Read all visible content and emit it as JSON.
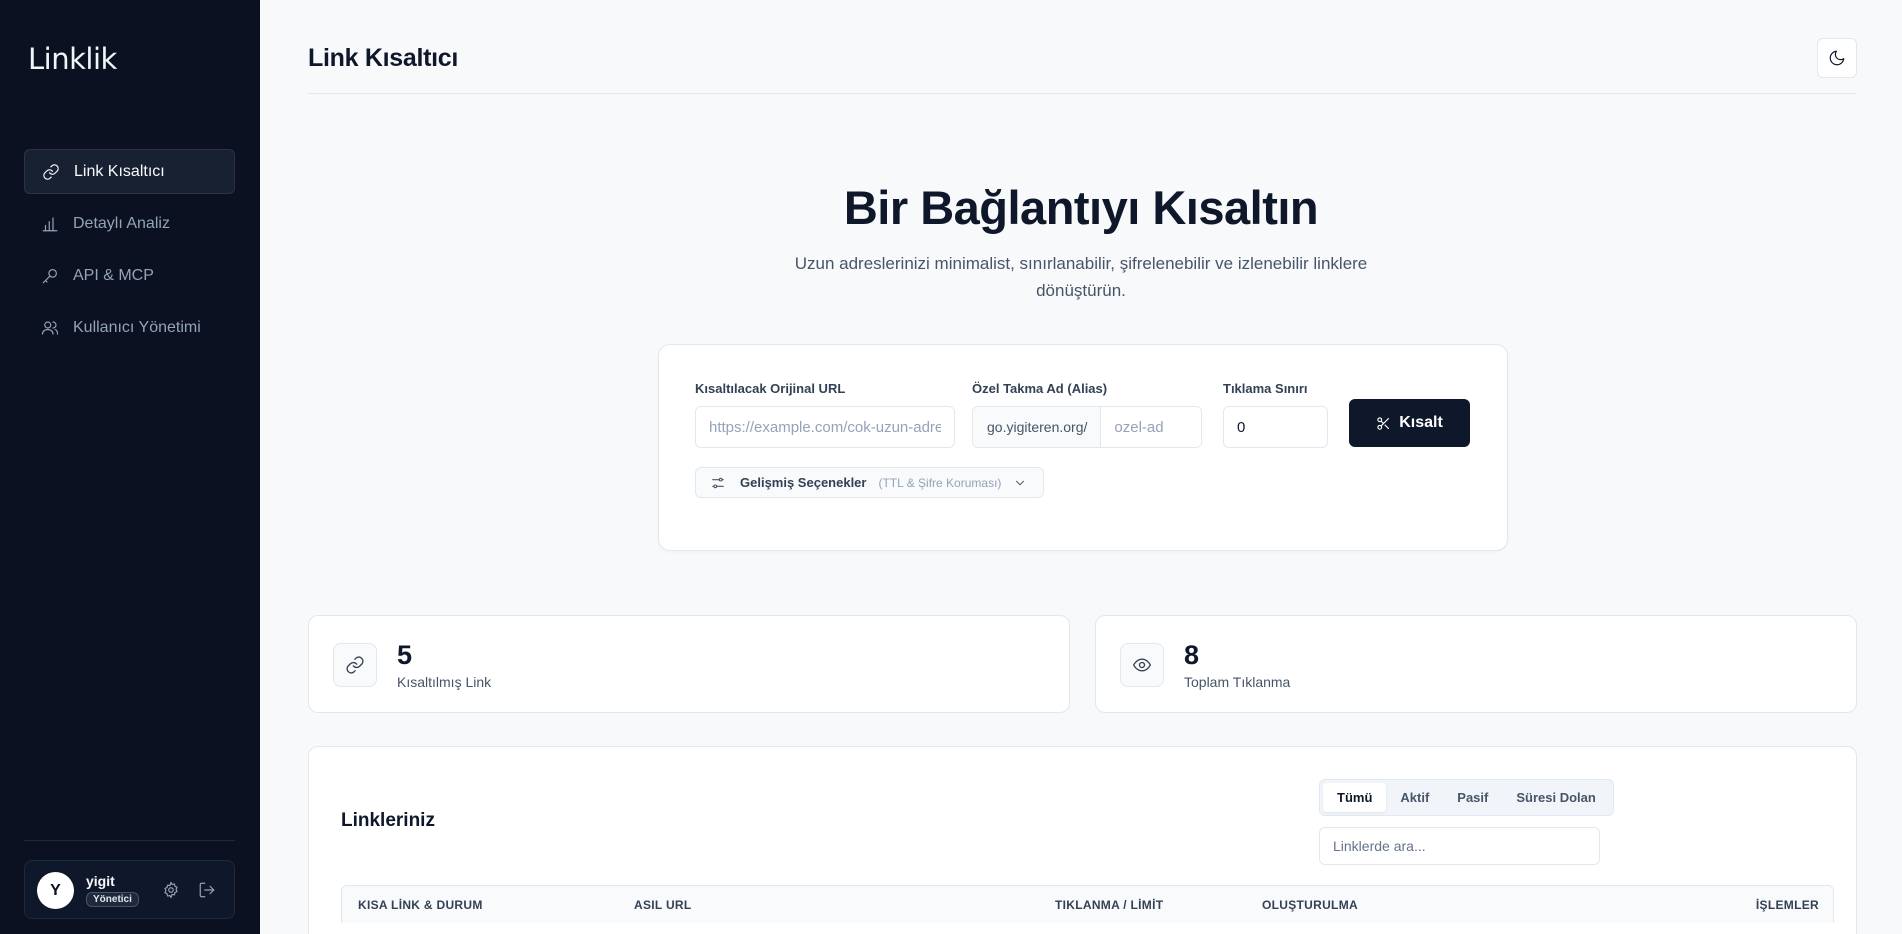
{
  "sidebar": {
    "logo": "Linklik",
    "items": [
      {
        "label": "Link Kısaltıcı",
        "icon": "link-icon"
      },
      {
        "label": "Detaylı Analiz",
        "icon": "bar-chart-icon"
      },
      {
        "label": "API & MCP",
        "icon": "key-icon"
      },
      {
        "label": "Kullanıcı Yönetimi",
        "icon": "users-icon"
      }
    ],
    "user": {
      "initial": "Y",
      "name": "yigit",
      "role": "Yönetici"
    }
  },
  "header": {
    "title": "Link Kısaltıcı"
  },
  "hero": {
    "title": "Bir Bağlantıyı Kısaltın",
    "subtitle": "Uzun adreslerinizi minimalist, sınırlanabilir, şifrelenebilir ve izlenebilir linklere dönüştürün."
  },
  "form": {
    "url_label": "Kısaltılacak Orijinal URL",
    "url_placeholder": "https://example.com/cok-uzun-adres",
    "alias_label": "Özel Takma Ad (Alias)",
    "alias_prefix": "go.yigiteren.org/",
    "alias_placeholder": "ozel-ad",
    "limit_label": "Tıklama Sınırı",
    "limit_value": "0",
    "submit_label": "Kısalt",
    "advanced_label": "Gelişmiş Seçenekler",
    "advanced_hint": "(TTL & Şifre Koruması)"
  },
  "stats": [
    {
      "value": "5",
      "label": "Kısaltılmış Link"
    },
    {
      "value": "8",
      "label": "Toplam Tıklanma"
    }
  ],
  "links": {
    "title": "Linkleriniz",
    "filters": [
      "Tümü",
      "Aktif",
      "Pasif",
      "Süresi Dolan"
    ],
    "active_filter": "Tümü",
    "search_placeholder": "Linklerde ara...",
    "columns": [
      "KISA LİNK & DURUM",
      "ASIL URL",
      "TIKLANMA / LİMİT",
      "OLUŞTURULMA",
      "İŞLEMLER"
    ]
  }
}
